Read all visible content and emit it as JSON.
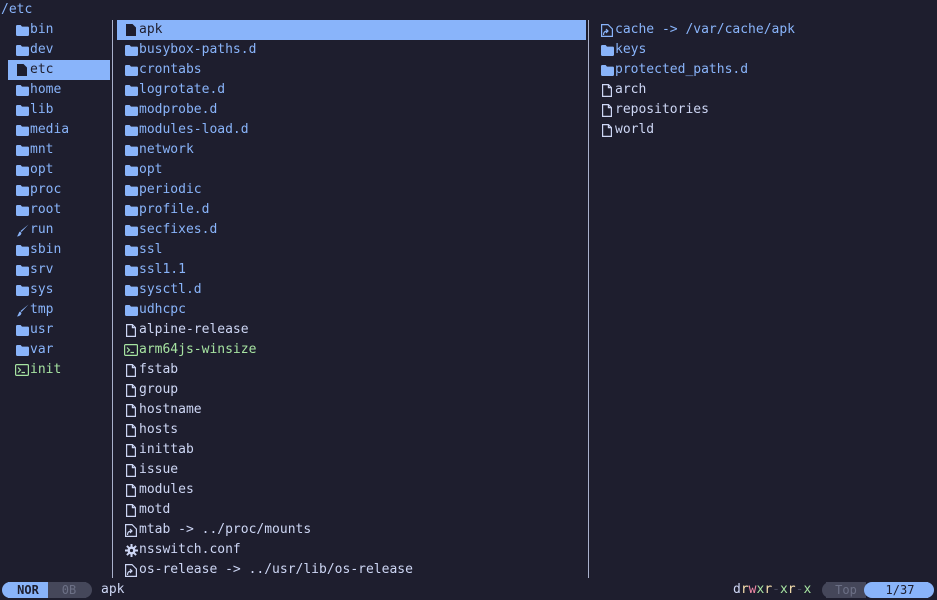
{
  "header": {
    "path": "/etc"
  },
  "parent_pane": {
    "items": [
      {
        "name": "bin",
        "type": "dir",
        "icon": "folder-icon"
      },
      {
        "name": "dev",
        "type": "dir",
        "icon": "folder-icon"
      },
      {
        "name": "etc",
        "type": "dir",
        "icon": "file-icon",
        "selected": true
      },
      {
        "name": "home",
        "type": "dir",
        "icon": "folder-icon"
      },
      {
        "name": "lib",
        "type": "dir",
        "icon": "folder-icon"
      },
      {
        "name": "media",
        "type": "dir",
        "icon": "folder-icon"
      },
      {
        "name": "mnt",
        "type": "dir",
        "icon": "folder-icon"
      },
      {
        "name": "opt",
        "type": "dir",
        "icon": "folder-icon"
      },
      {
        "name": "proc",
        "type": "dir",
        "icon": "folder-icon"
      },
      {
        "name": "root",
        "type": "dir",
        "icon": "folder-icon"
      },
      {
        "name": "run",
        "type": "dir",
        "icon": "brush-icon"
      },
      {
        "name": "sbin",
        "type": "dir",
        "icon": "folder-icon"
      },
      {
        "name": "srv",
        "type": "dir",
        "icon": "folder-icon"
      },
      {
        "name": "sys",
        "type": "dir",
        "icon": "folder-icon"
      },
      {
        "name": "tmp",
        "type": "dir",
        "icon": "brush-icon"
      },
      {
        "name": "usr",
        "type": "dir",
        "icon": "folder-icon"
      },
      {
        "name": "var",
        "type": "dir",
        "icon": "folder-icon"
      },
      {
        "name": "init",
        "type": "exec",
        "icon": "terminal-icon"
      }
    ]
  },
  "current_pane": {
    "items": [
      {
        "name": "apk",
        "type": "dir",
        "icon": "file-icon",
        "selected": true
      },
      {
        "name": "busybox-paths.d",
        "type": "dir",
        "icon": "folder-icon"
      },
      {
        "name": "crontabs",
        "type": "dir",
        "icon": "folder-icon"
      },
      {
        "name": "logrotate.d",
        "type": "dir",
        "icon": "folder-icon"
      },
      {
        "name": "modprobe.d",
        "type": "dir",
        "icon": "folder-icon"
      },
      {
        "name": "modules-load.d",
        "type": "dir",
        "icon": "folder-icon"
      },
      {
        "name": "network",
        "type": "dir",
        "icon": "folder-icon"
      },
      {
        "name": "opt",
        "type": "dir",
        "icon": "folder-icon"
      },
      {
        "name": "periodic",
        "type": "dir",
        "icon": "folder-icon"
      },
      {
        "name": "profile.d",
        "type": "dir",
        "icon": "folder-icon"
      },
      {
        "name": "secfixes.d",
        "type": "dir",
        "icon": "folder-icon"
      },
      {
        "name": "ssl",
        "type": "dir",
        "icon": "folder-icon"
      },
      {
        "name": "ssl1.1",
        "type": "dir",
        "icon": "folder-icon"
      },
      {
        "name": "sysctl.d",
        "type": "dir",
        "icon": "folder-icon"
      },
      {
        "name": "udhcpc",
        "type": "dir",
        "icon": "folder-icon"
      },
      {
        "name": "alpine-release",
        "type": "file",
        "icon": "file-icon"
      },
      {
        "name": "arm64js-winsize",
        "type": "exec",
        "icon": "terminal-icon"
      },
      {
        "name": "fstab",
        "type": "file",
        "icon": "file-icon"
      },
      {
        "name": "group",
        "type": "file",
        "icon": "file-icon"
      },
      {
        "name": "hostname",
        "type": "file",
        "icon": "file-icon"
      },
      {
        "name": "hosts",
        "type": "file",
        "icon": "file-icon"
      },
      {
        "name": "inittab",
        "type": "file",
        "icon": "file-icon"
      },
      {
        "name": "issue",
        "type": "file",
        "icon": "file-icon"
      },
      {
        "name": "modules",
        "type": "file",
        "icon": "file-icon"
      },
      {
        "name": "motd",
        "type": "file",
        "icon": "file-icon"
      },
      {
        "name": "mtab -> ../proc/mounts",
        "type": "file",
        "icon": "symlink-icon"
      },
      {
        "name": "nsswitch.conf",
        "type": "file",
        "icon": "gear-icon"
      },
      {
        "name": "os-release -> ../usr/lib/os-release",
        "type": "file",
        "icon": "symlink-icon"
      }
    ]
  },
  "preview_pane": {
    "items": [
      {
        "name": "cache -> /var/cache/apk",
        "type": "link",
        "icon": "symlink-icon"
      },
      {
        "name": "keys",
        "type": "dir",
        "icon": "folder-icon"
      },
      {
        "name": "protected_paths.d",
        "type": "dir",
        "icon": "folder-icon"
      },
      {
        "name": "arch",
        "type": "file",
        "icon": "file-icon"
      },
      {
        "name": "repositories",
        "type": "file",
        "icon": "file-icon"
      },
      {
        "name": "world",
        "type": "file",
        "icon": "file-icon"
      }
    ]
  },
  "status_bar": {
    "mode": "NOR",
    "size": "0B",
    "filename": "apk",
    "permissions": "drwxr-xr-x",
    "position_label": "Top",
    "position_count": "1/37"
  },
  "colors": {
    "background": "#1e1e2e",
    "accent": "#89b4fa",
    "text": "#cdd6f4",
    "exec": "#a6e3a1",
    "muted": "#45475a"
  }
}
